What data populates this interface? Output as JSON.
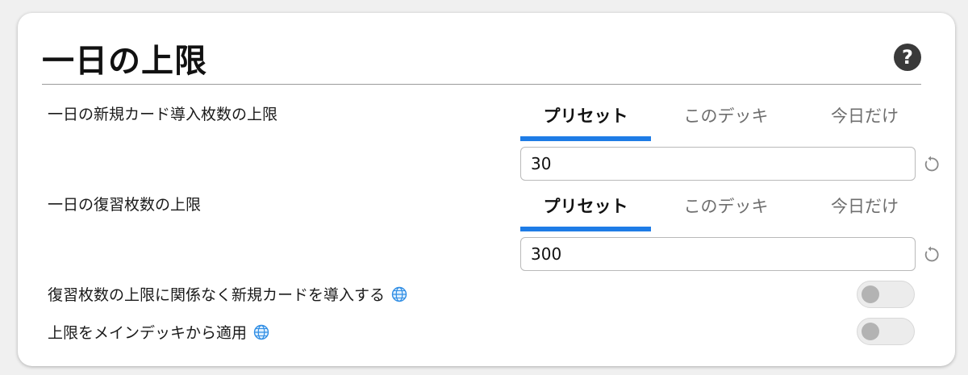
{
  "section": {
    "title": "一日の上限",
    "help_icon": "?"
  },
  "new_cards_limit": {
    "label": "一日の新規カード導入枚数の上限",
    "tabs": [
      {
        "label": "プリセット",
        "active": true
      },
      {
        "label": "このデッキ",
        "active": false
      },
      {
        "label": "今日だけ",
        "active": false
      }
    ],
    "value": "30"
  },
  "review_limit": {
    "label": "一日の復習枚数の上限",
    "tabs": [
      {
        "label": "プリセット",
        "active": true
      },
      {
        "label": "このデッキ",
        "active": false
      },
      {
        "label": "今日だけ",
        "active": false
      }
    ],
    "value": "300"
  },
  "options": [
    {
      "label": "復習枚数の上限に関係なく新規カードを導入する",
      "icon": "globe-icon",
      "enabled": false
    },
    {
      "label": "上限をメインデッキから適用",
      "icon": "globe-icon",
      "enabled": false
    }
  ],
  "colors": {
    "accent": "#1e7ce6",
    "help_icon_bg": "#3a3a3a",
    "toggle_off": "#ececec"
  }
}
